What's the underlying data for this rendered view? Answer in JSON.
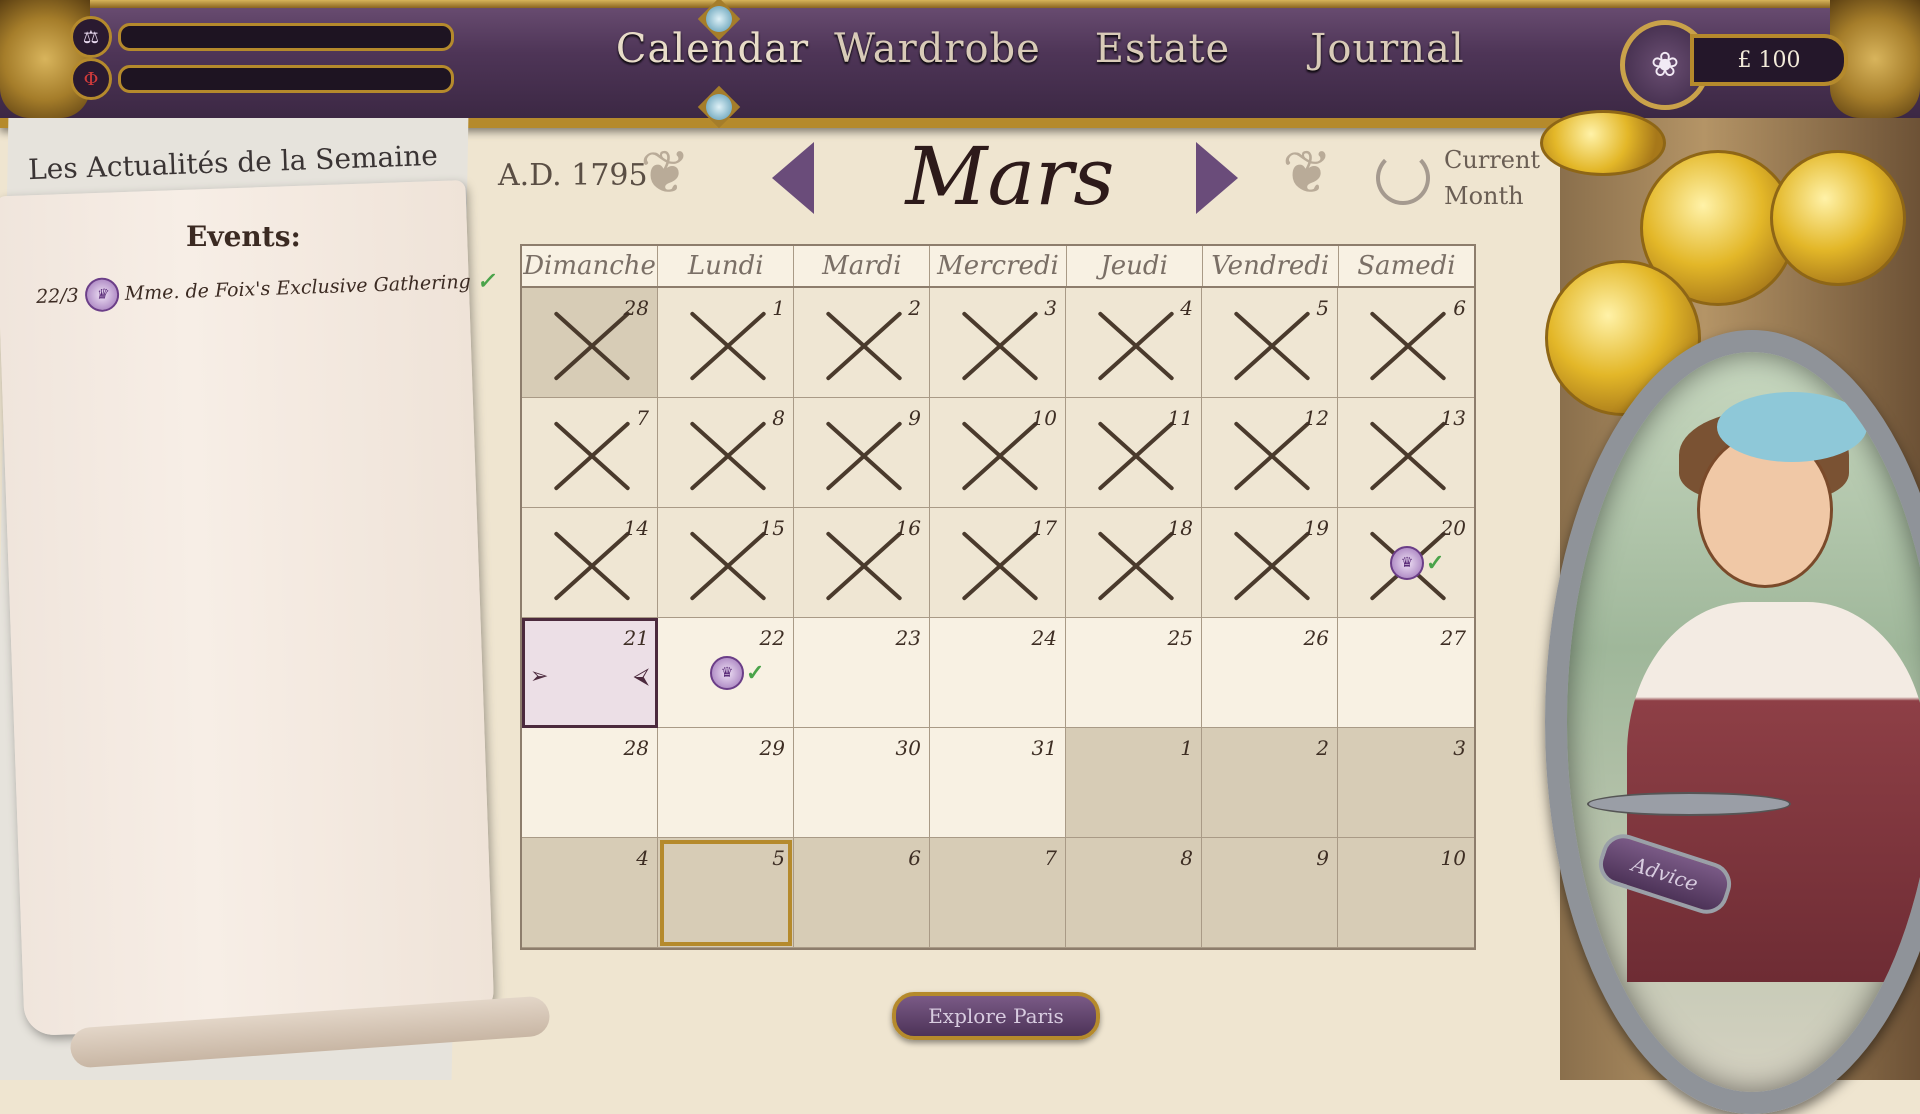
{
  "header": {
    "nav": [
      "Calendar",
      "Wardrobe",
      "Estate",
      "Journal"
    ],
    "active_nav": "Calendar",
    "money": "£ 100",
    "stat_icons": [
      "scales-icon",
      "phi-icon"
    ],
    "money_icon": "rose-icon"
  },
  "newspaper": {
    "title": "Les Actualités de la Semaine"
  },
  "events_panel": {
    "title": "Events:",
    "items": [
      {
        "date": "22/3",
        "name": "Mme. de Foix's Exclusive Gathering",
        "icon": "crown-icon",
        "status_icon": "quill-check-icon"
      }
    ]
  },
  "calendar": {
    "year": "A.D. 1795",
    "month": "Mars",
    "current_month_label_1": "Current",
    "current_month_label_2": "Month",
    "weekdays": [
      "Dimanche",
      "Lundi",
      "Mardi",
      "Mercredi",
      "Jeudi",
      "Vendredi",
      "Samedi"
    ],
    "days": [
      {
        "d": "28",
        "state": "past-other"
      },
      {
        "d": "1",
        "state": "past"
      },
      {
        "d": "2",
        "state": "past"
      },
      {
        "d": "3",
        "state": "past"
      },
      {
        "d": "4",
        "state": "past"
      },
      {
        "d": "5",
        "state": "past"
      },
      {
        "d": "6",
        "state": "past"
      },
      {
        "d": "7",
        "state": "past"
      },
      {
        "d": "8",
        "state": "past"
      },
      {
        "d": "9",
        "state": "past"
      },
      {
        "d": "10",
        "state": "past"
      },
      {
        "d": "11",
        "state": "past"
      },
      {
        "d": "12",
        "state": "past"
      },
      {
        "d": "13",
        "state": "past"
      },
      {
        "d": "14",
        "state": "past"
      },
      {
        "d": "15",
        "state": "past"
      },
      {
        "d": "16",
        "state": "past"
      },
      {
        "d": "17",
        "state": "past"
      },
      {
        "d": "18",
        "state": "past"
      },
      {
        "d": "19",
        "state": "past"
      },
      {
        "d": "20",
        "state": "past",
        "event": true
      },
      {
        "d": "21",
        "state": "today"
      },
      {
        "d": "22",
        "state": "future",
        "event": true
      },
      {
        "d": "23",
        "state": "future"
      },
      {
        "d": "24",
        "state": "future"
      },
      {
        "d": "25",
        "state": "future"
      },
      {
        "d": "26",
        "state": "future"
      },
      {
        "d": "27",
        "state": "future"
      },
      {
        "d": "28",
        "state": "future"
      },
      {
        "d": "29",
        "state": "future"
      },
      {
        "d": "30",
        "state": "future"
      },
      {
        "d": "31",
        "state": "future"
      },
      {
        "d": "1",
        "state": "other"
      },
      {
        "d": "2",
        "state": "other"
      },
      {
        "d": "3",
        "state": "other"
      },
      {
        "d": "4",
        "state": "other"
      },
      {
        "d": "5",
        "state": "other-hover"
      },
      {
        "d": "6",
        "state": "other"
      },
      {
        "d": "7",
        "state": "other"
      },
      {
        "d": "8",
        "state": "other"
      },
      {
        "d": "9",
        "state": "other"
      },
      {
        "d": "10",
        "state": "other"
      }
    ]
  },
  "buttons": {
    "explore": "Explore Paris",
    "advice": "Advice"
  },
  "colors": {
    "accent_purple": "#4d3358",
    "gold_trim": "#b58a2c",
    "parchment": "#f8f1e3"
  }
}
